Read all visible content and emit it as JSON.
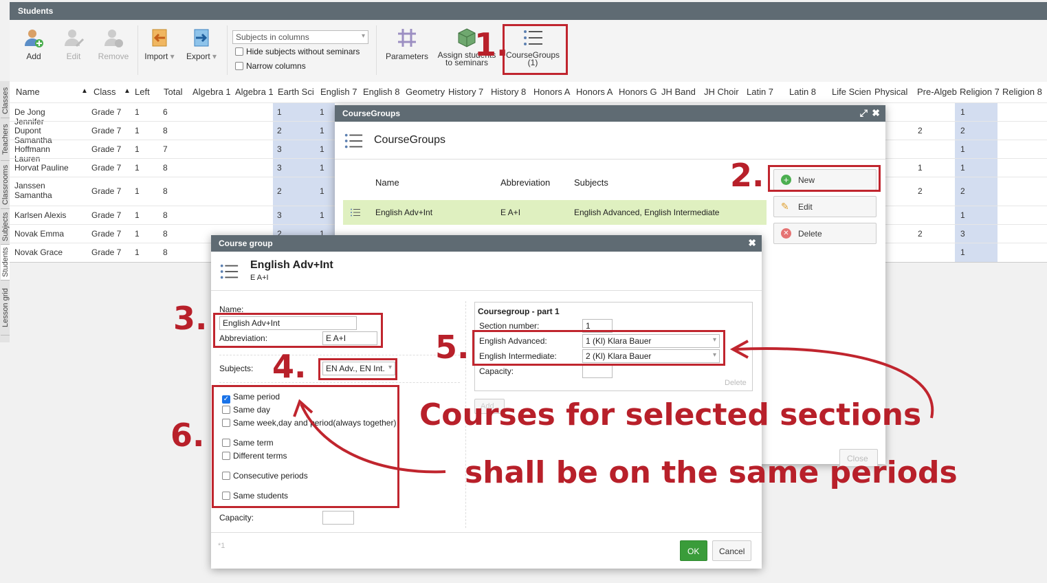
{
  "window": {
    "title": "Students"
  },
  "side_tabs": [
    "Classes",
    "Teachers",
    "Classrooms",
    "Subjects",
    "Students",
    "Lesson grid"
  ],
  "toolbar": {
    "add": "Add",
    "edit": "Edit",
    "remove": "Remove",
    "import": "Import",
    "export": "Export",
    "view_select": "Subjects in columns",
    "hide_subjects": "Hide subjects without seminars",
    "narrow_columns": "Narrow columns",
    "parameters": "Parameters",
    "assign_line1": "Assign students",
    "assign_line2": "to seminars",
    "coursegroups_line1": "CourseGroups",
    "coursegroups_line2": "(1)"
  },
  "grid": {
    "headers": [
      "Name",
      "Class",
      "Left",
      "Total",
      "Algebra 1",
      "Algebra 1",
      "Earth Sci",
      "English 7",
      "English 8",
      "Geometry",
      "History 7",
      "History 8",
      "Honors A",
      "Honors A",
      "Honors G",
      "JH Band",
      "JH Choir",
      "Latin 7",
      "Latin 8",
      "Life Scien",
      "Physical",
      "Pre-Algeb",
      "Religion 7",
      "Religion 8"
    ],
    "sort_arrows": [
      "▲",
      "▲"
    ],
    "rows": [
      {
        "name": "De Jong Jennifer",
        "class": "Grade 7",
        "left": "1",
        "total": "6",
        "c1": "1",
        "c2": "1",
        "r1": "",
        "r2": "1"
      },
      {
        "name": "Dupont Samantha",
        "class": "Grade 7",
        "left": "1",
        "total": "8",
        "c1": "2",
        "c2": "1",
        "r1": "2",
        "r2": "2"
      },
      {
        "name": "Hoffmann Lauren",
        "class": "Grade 7",
        "left": "1",
        "total": "7",
        "c1": "3",
        "c2": "1",
        "r1": "",
        "r2": "1"
      },
      {
        "name": "Horvat Pauline",
        "class": "Grade 7",
        "left": "1",
        "total": "8",
        "c1": "3",
        "c2": "1",
        "r1": "1",
        "r2": "1"
      },
      {
        "name": "Janssen Samantha",
        "class": "Grade 7",
        "left": "1",
        "total": "8",
        "c1": "2",
        "c2": "1",
        "r1": "2",
        "r2": "2"
      },
      {
        "name": "Karlsen Alexis",
        "class": "Grade 7",
        "left": "1",
        "total": "8",
        "c1": "3",
        "c2": "1",
        "r1": "",
        "r2": "1"
      },
      {
        "name": "Novak Emma",
        "class": "Grade 7",
        "left": "1",
        "total": "8",
        "c1": "2",
        "c2": "1",
        "r1": "2",
        "r2": "3"
      },
      {
        "name": "Novak Grace",
        "class": "Grade 7",
        "left": "1",
        "total": "8",
        "c1": "",
        "c2": "",
        "r1": "",
        "r2": "1"
      }
    ]
  },
  "coursegroups": {
    "title": "CourseGroups",
    "heading": "CourseGroups",
    "col_name": "Name",
    "col_abbr": "Abbreviation",
    "col_subjects": "Subjects",
    "row": {
      "name": "English Adv+Int",
      "abbr": "E A+I",
      "subjects": "English Advanced, English Intermediate"
    },
    "new": "New",
    "edit": "Edit",
    "delete": "Delete",
    "close": "Close"
  },
  "coursegroup": {
    "title": "Course group",
    "heading": "English Adv+Int",
    "subheading": "E A+I",
    "name_label": "Name:",
    "name_value": "English Adv+Int",
    "abbr_label": "Abbreviation:",
    "abbr_value": "E A+I",
    "subjects_label": "Subjects:",
    "subjects_value": "EN Adv., EN Int.",
    "options": [
      {
        "label": "Same period",
        "checked": true
      },
      {
        "label": "Same day",
        "checked": false
      },
      {
        "label": "Same week,day and period(always together)",
        "checked": false
      },
      {
        "label": "Same term",
        "checked": false
      },
      {
        "label": "Different terms",
        "checked": false
      },
      {
        "label": "Consecutive periods",
        "checked": false
      },
      {
        "label": "Same students",
        "checked": false
      }
    ],
    "capacity_label": "Capacity:",
    "footnote": "*1",
    "part_title": "Coursegroup - part 1",
    "section_label": "Section number:",
    "section_value": "1",
    "adv_label": "English Advanced:",
    "adv_value": "1 (Kl) Klara Bauer",
    "int_label": "English Intermediate:",
    "int_value": "2 (Kl) Klara Bauer",
    "part_capacity_label": "Capacity:",
    "part_delete": "Delete",
    "add": "Add",
    "ok": "OK",
    "cancel": "Cancel"
  },
  "annotations": {
    "n1": "1.",
    "n2": "2.",
    "n3": "3.",
    "n4": "4.",
    "n5": "5.",
    "n6": "6.",
    "line1": "Courses for selected sections",
    "line2": "shall be on the same periods"
  },
  "colors": {
    "titlebar": "#5f6b73",
    "blue_col": "#d3ddf0",
    "selected_row": "#dff0c0",
    "annotation": "#c0252e",
    "ok": "#3a9c3a"
  }
}
